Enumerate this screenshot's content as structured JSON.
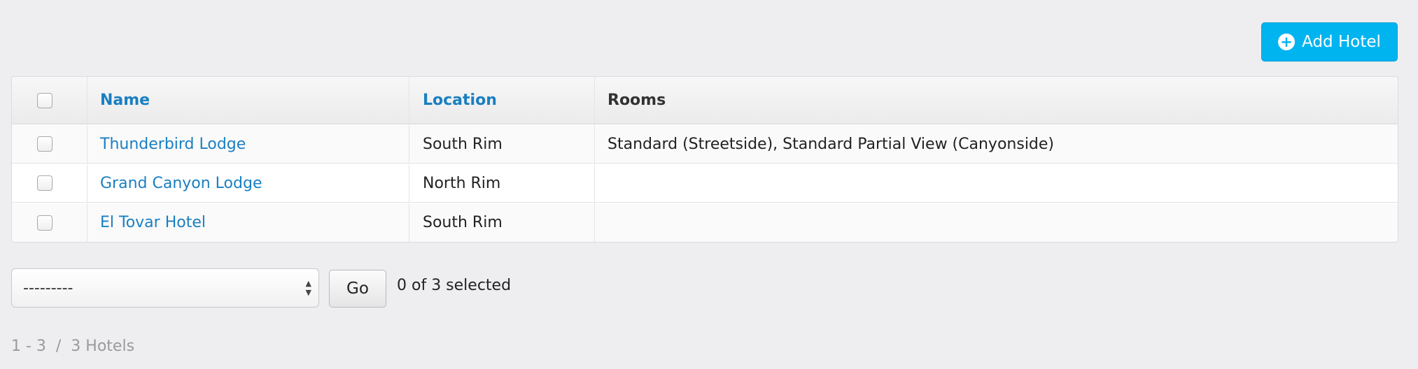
{
  "toolbar": {
    "add_label": "Add Hotel",
    "add_icon": "plus-circle-icon"
  },
  "table": {
    "columns": {
      "name": "Name",
      "location": "Location",
      "rooms": "Rooms"
    },
    "rows": [
      {
        "name": "Thunderbird Lodge",
        "location": "South Rim",
        "rooms": "Standard (Streetside), Standard Partial View (Canyonside)",
        "checked": false
      },
      {
        "name": "Grand Canyon Lodge",
        "location": "North Rim",
        "rooms": "",
        "checked": false
      },
      {
        "name": "El Tovar Hotel",
        "location": "South Rim",
        "rooms": "",
        "checked": false
      }
    ]
  },
  "actions": {
    "select_value": "---------",
    "go_label": "Go",
    "selection_count": "0 of 3 selected"
  },
  "paginator": {
    "text": "1 - 3  /  3 Hotels"
  },
  "colors": {
    "accent": "#00b4f0",
    "link": "#1a7fc1",
    "background": "#eeeef0"
  }
}
